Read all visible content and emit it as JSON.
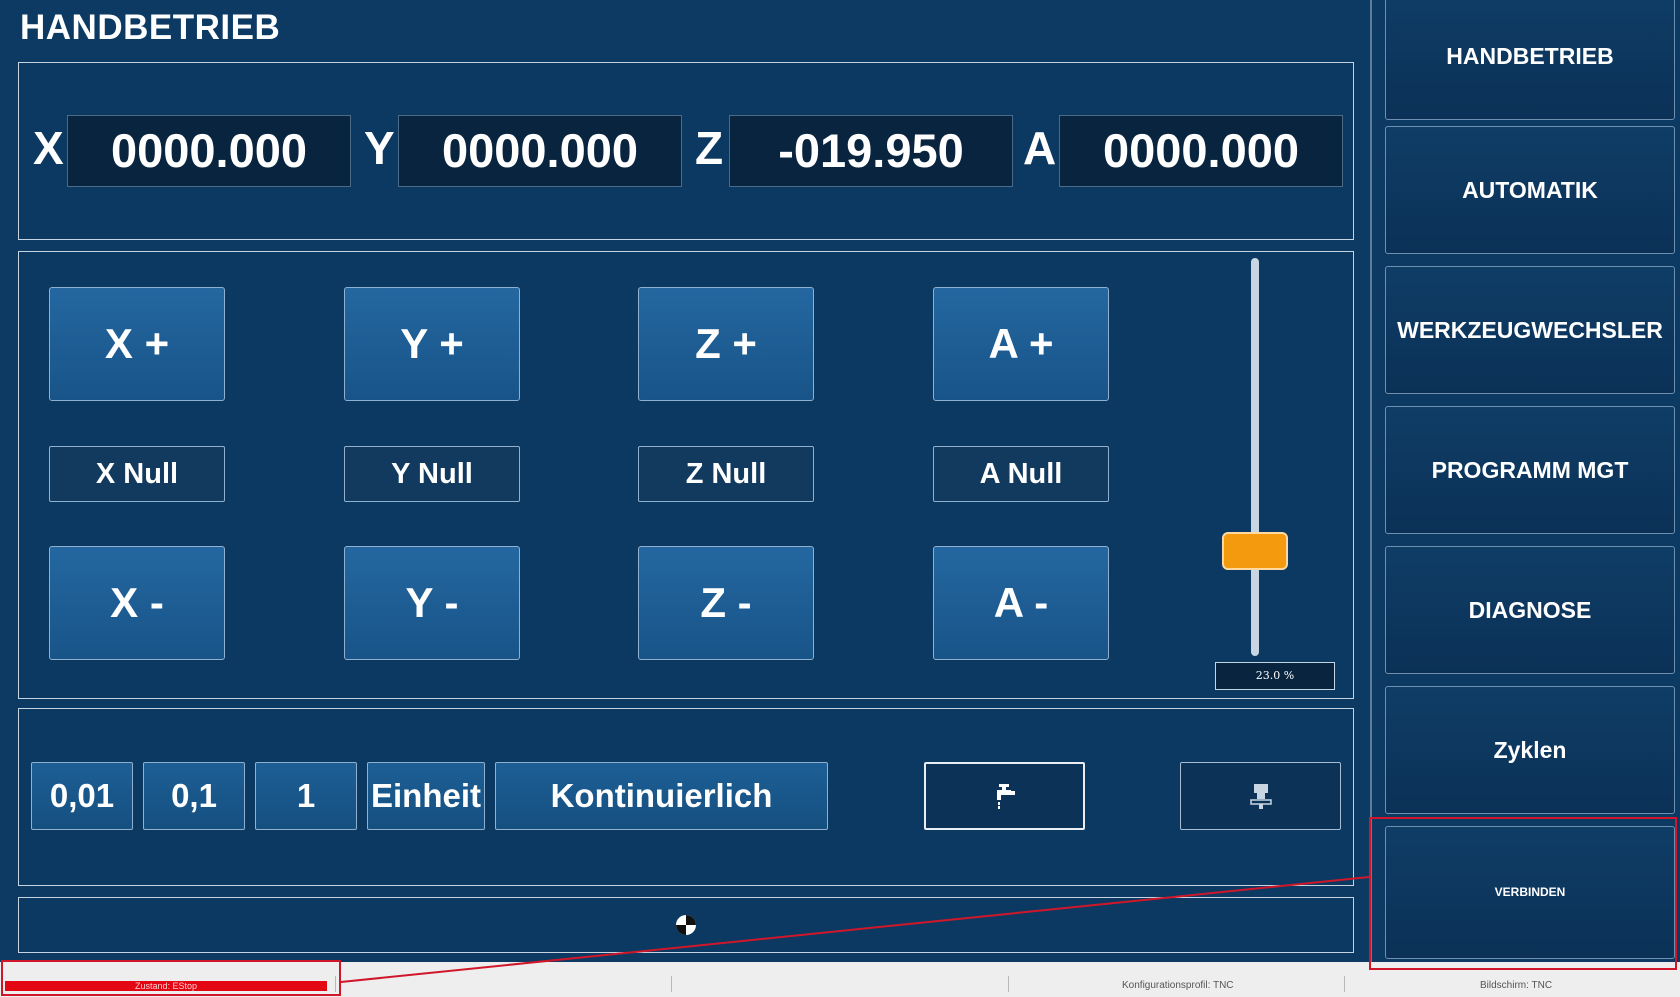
{
  "title": "HANDBETRIEB",
  "axes": [
    {
      "letter": "X",
      "value": "0000.000"
    },
    {
      "letter": "Y",
      "value": "0000.000"
    },
    {
      "letter": "Z",
      "value": "-019.950"
    },
    {
      "letter": "A",
      "value": "0000.000"
    }
  ],
  "jog": {
    "plus": [
      "X +",
      "Y +",
      "Z +",
      "A +"
    ],
    "null": [
      "X Null",
      "Y Null",
      "Z Null",
      "A Null"
    ],
    "minus": [
      "X -",
      "Y -",
      "Z -",
      "A -"
    ]
  },
  "feed_override": {
    "label": "23.0 %",
    "value_percent": 23.0
  },
  "steps": {
    "s001": "0,01",
    "s01": "0,1",
    "s1": "1",
    "unit": "Einheit",
    "continuous": "Kontinuierlich"
  },
  "icons": {
    "coolant": "coolant-tap-icon",
    "spindle": "spindle-icon",
    "origin": "origin-marker-icon"
  },
  "sidebar": [
    {
      "label": "HANDBETRIEB"
    },
    {
      "label": "AUTOMATIK"
    },
    {
      "label": "WERKZEUGWECHSLER"
    },
    {
      "label": "PROGRAMM MGT"
    },
    {
      "label": "DIAGNOSE"
    },
    {
      "label": "Zyklen"
    },
    {
      "label": "VERBINDEN"
    }
  ],
  "status": {
    "state": "Zustand: EStop",
    "profile": "Konfigurationsprofil: TNC",
    "screen": "Bildschirm: TNC"
  },
  "colors": {
    "background": "#0d3a63",
    "button": "#1d5f95",
    "slider_thumb": "#f39a0e",
    "estop": "#e30613",
    "highlight": "#d0172a"
  }
}
